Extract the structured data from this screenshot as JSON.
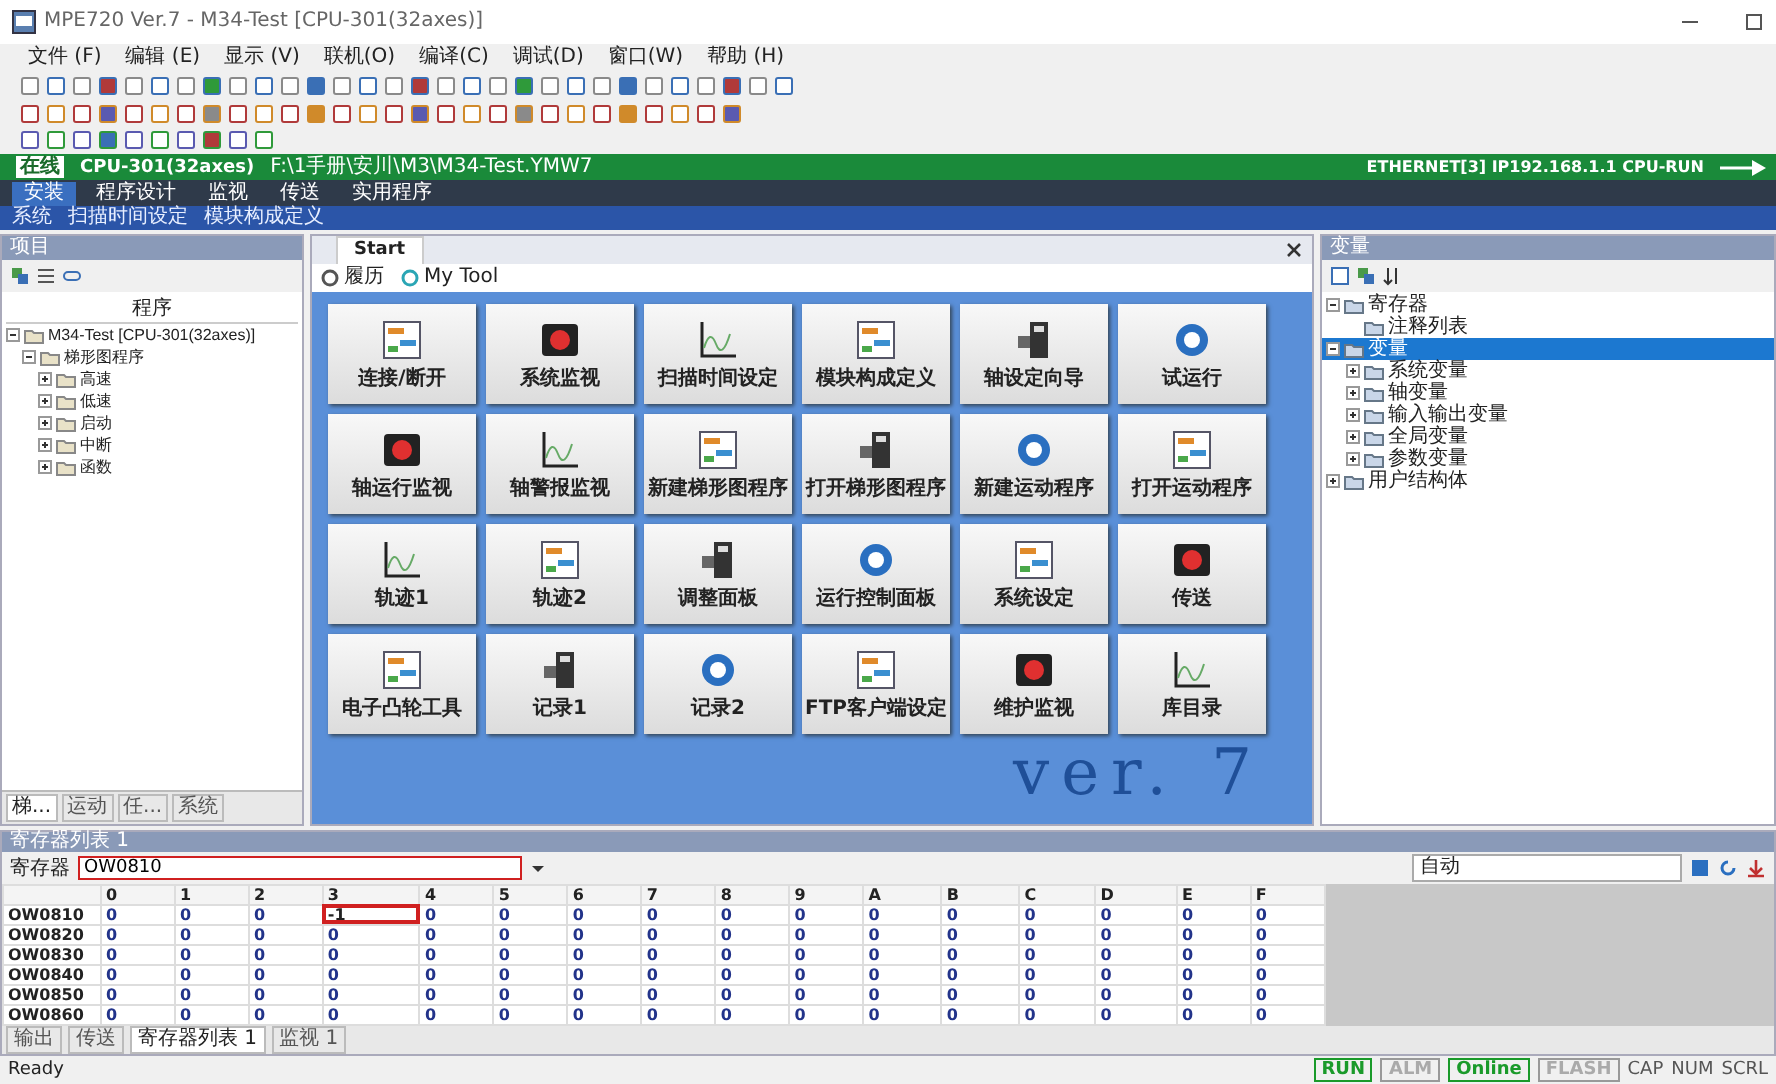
{
  "window": {
    "title": "MPE720 Ver.7 - M34-Test [CPU-301(32axes)]"
  },
  "menu": [
    "文件 (F)",
    "编辑 (E)",
    "显示 (V)",
    "联机(O)",
    "编译(C)",
    "调试(D)",
    "窗口(W)",
    "帮助 (H)"
  ],
  "connection_bar": {
    "state": "在线",
    "cpu": "CPU-301(32axes)",
    "path": "F:\\1手册\\安川\\M3\\M34-Test.YMW7",
    "link": "ETHERNET[3] IP192.168.1.1 CPU-RUN"
  },
  "ribbon": {
    "tabs": [
      {
        "label": "安装",
        "selected": true
      },
      {
        "label": "程序设计",
        "selected": false
      },
      {
        "label": "监视",
        "selected": false
      },
      {
        "label": "传送",
        "selected": false
      },
      {
        "label": "实用程序",
        "selected": false
      }
    ],
    "commands": [
      "系统",
      "扫描时间设定",
      "模块构成定义"
    ]
  },
  "left_panel": {
    "title": "项目",
    "tree_header": "程序",
    "tree": [
      {
        "label": "M34-Test [CPU-301(32axes)]",
        "expanded": true,
        "selected": false,
        "children": [
          {
            "label": "梯形图程序",
            "expanded": true,
            "selected": false,
            "children": [
              {
                "label": "高速",
                "expanded": false,
                "selected": false
              },
              {
                "label": "低速",
                "expanded": false,
                "selected": false
              },
              {
                "label": "启动",
                "expanded": false,
                "selected": false
              },
              {
                "label": "中断",
                "expanded": false,
                "selected": false
              },
              {
                "label": "函数",
                "expanded": false,
                "selected": false
              }
            ]
          }
        ]
      }
    ],
    "tabs": [
      {
        "label": "梯...",
        "selected": true
      },
      {
        "label": "运动",
        "selected": false
      },
      {
        "label": "任...",
        "selected": false
      },
      {
        "label": "系统",
        "selected": false
      }
    ]
  },
  "start_page": {
    "tab": "Start",
    "links": [
      "履历",
      "My Tool"
    ],
    "watermark": "ver. 7",
    "tiles": [
      {
        "label": "连接/断开"
      },
      {
        "label": "系统监视"
      },
      {
        "label": "扫描时间设定"
      },
      {
        "label": "模块构成定义"
      },
      {
        "label": "轴设定向导"
      },
      {
        "label": "试运行"
      },
      {
        "label": "轴运行监视"
      },
      {
        "label": "轴警报监视"
      },
      {
        "label": "新建梯形图程序"
      },
      {
        "label": "打开梯形图程序"
      },
      {
        "label": "新建运动程序"
      },
      {
        "label": "打开运动程序"
      },
      {
        "label": "轨迹1"
      },
      {
        "label": "轨迹2"
      },
      {
        "label": "调整面板"
      },
      {
        "label": "运行控制面板"
      },
      {
        "label": "系统设定"
      },
      {
        "label": "传送"
      },
      {
        "label": "电子凸轮工具"
      },
      {
        "label": "记录1"
      },
      {
        "label": "记录2"
      },
      {
        "label": "FTP客户端设定"
      },
      {
        "label": "维护监视"
      },
      {
        "label": "库目录"
      }
    ]
  },
  "right_panel": {
    "title": "变量",
    "tree": [
      {
        "label": "寄存器",
        "expanded": true,
        "selected": false,
        "children": [
          {
            "label": "注释列表",
            "selected": false
          }
        ]
      },
      {
        "label": "变量",
        "expanded": true,
        "selected": true,
        "children": [
          {
            "label": "系统变量",
            "expanded": false,
            "selected": false
          },
          {
            "label": "轴变量",
            "expanded": false,
            "selected": false
          },
          {
            "label": "输入输出变量",
            "expanded": false,
            "selected": false
          },
          {
            "label": "全局变量",
            "expanded": false,
            "selected": false
          },
          {
            "label": "参数变量",
            "expanded": false,
            "selected": false
          }
        ]
      },
      {
        "label": "用户结构体",
        "expanded": false,
        "selected": false
      }
    ]
  },
  "register_list": {
    "title": "寄存器列表 1",
    "register_label": "寄存器",
    "register_value": "OW0810",
    "mode": "自动",
    "columns": [
      "0",
      "1",
      "2",
      "3",
      "4",
      "5",
      "6",
      "7",
      "8",
      "9",
      "A",
      "B",
      "C",
      "D",
      "E",
      "F"
    ],
    "rows": [
      {
        "address": "OW0810",
        "cells": [
          {
            "value": "0",
            "selected": false
          },
          {
            "value": "0",
            "selected": false
          },
          {
            "value": "0",
            "selected": false
          },
          {
            "value": "-1",
            "selected": true
          },
          {
            "value": "0",
            "selected": false
          },
          {
            "value": "0",
            "selected": false
          },
          {
            "value": "0",
            "selected": false
          },
          {
            "value": "0",
            "selected": false
          },
          {
            "value": "0",
            "selected": false
          },
          {
            "value": "0",
            "selected": false
          },
          {
            "value": "0",
            "selected": false
          },
          {
            "value": "0",
            "selected": false
          },
          {
            "value": "0",
            "selected": false
          },
          {
            "value": "0",
            "selected": false
          },
          {
            "value": "0",
            "selected": false
          },
          {
            "value": "0",
            "selected": false
          }
        ]
      },
      {
        "address": "OW0820",
        "cells": [
          {
            "value": "0",
            "selected": false
          },
          {
            "value": "0",
            "selected": false
          },
          {
            "value": "0",
            "selected": false
          },
          {
            "value": "0",
            "selected": false
          },
          {
            "value": "0",
            "selected": false
          },
          {
            "value": "0",
            "selected": false
          },
          {
            "value": "0",
            "selected": false
          },
          {
            "value": "0",
            "selected": false
          },
          {
            "value": "0",
            "selected": false
          },
          {
            "value": "0",
            "selected": false
          },
          {
            "value": "0",
            "selected": false
          },
          {
            "value": "0",
            "selected": false
          },
          {
            "value": "0",
            "selected": false
          },
          {
            "value": "0",
            "selected": false
          },
          {
            "value": "0",
            "selected": false
          },
          {
            "value": "0",
            "selected": false
          }
        ]
      },
      {
        "address": "OW0830",
        "cells": [
          {
            "value": "0",
            "selected": false
          },
          {
            "value": "0",
            "selected": false
          },
          {
            "value": "0",
            "selected": false
          },
          {
            "value": "0",
            "selected": false
          },
          {
            "value": "0",
            "selected": false
          },
          {
            "value": "0",
            "selected": false
          },
          {
            "value": "0",
            "selected": false
          },
          {
            "value": "0",
            "selected": false
          },
          {
            "value": "0",
            "selected": false
          },
          {
            "value": "0",
            "selected": false
          },
          {
            "value": "0",
            "selected": false
          },
          {
            "value": "0",
            "selected": false
          },
          {
            "value": "0",
            "selected": false
          },
          {
            "value": "0",
            "selected": false
          },
          {
            "value": "0",
            "selected": false
          },
          {
            "value": "0",
            "selected": false
          }
        ]
      },
      {
        "address": "OW0840",
        "cells": [
          {
            "value": "0",
            "selected": false
          },
          {
            "value": "0",
            "selected": false
          },
          {
            "value": "0",
            "selected": false
          },
          {
            "value": "0",
            "selected": false
          },
          {
            "value": "0",
            "selected": false
          },
          {
            "value": "0",
            "selected": false
          },
          {
            "value": "0",
            "selected": false
          },
          {
            "value": "0",
            "selected": false
          },
          {
            "value": "0",
            "selected": false
          },
          {
            "value": "0",
            "selected": false
          },
          {
            "value": "0",
            "selected": false
          },
          {
            "value": "0",
            "selected": false
          },
          {
            "value": "0",
            "selected": false
          },
          {
            "value": "0",
            "selected": false
          },
          {
            "value": "0",
            "selected": false
          },
          {
            "value": "0",
            "selected": false
          }
        ]
      },
      {
        "address": "OW0850",
        "cells": [
          {
            "value": "0",
            "selected": false
          },
          {
            "value": "0",
            "selected": false
          },
          {
            "value": "0",
            "selected": false
          },
          {
            "value": "0",
            "selected": false
          },
          {
            "value": "0",
            "selected": false
          },
          {
            "value": "0",
            "selected": false
          },
          {
            "value": "0",
            "selected": false
          },
          {
            "value": "0",
            "selected": false
          },
          {
            "value": "0",
            "selected": false
          },
          {
            "value": "0",
            "selected": false
          },
          {
            "value": "0",
            "selected": false
          },
          {
            "value": "0",
            "selected": false
          },
          {
            "value": "0",
            "selected": false
          },
          {
            "value": "0",
            "selected": false
          },
          {
            "value": "0",
            "selected": false
          },
          {
            "value": "0",
            "selected": false
          }
        ]
      },
      {
        "address": "OW0860",
        "cells": [
          {
            "value": "0",
            "selected": false
          },
          {
            "value": "0",
            "selected": false
          },
          {
            "value": "0",
            "selected": false
          },
          {
            "value": "0",
            "selected": false
          },
          {
            "value": "0",
            "selected": false
          },
          {
            "value": "0",
            "selected": false
          },
          {
            "value": "0",
            "selected": false
          },
          {
            "value": "0",
            "selected": false
          },
          {
            "value": "0",
            "selected": false
          },
          {
            "value": "0",
            "selected": false
          },
          {
            "value": "0",
            "selected": false
          },
          {
            "value": "0",
            "selected": false
          },
          {
            "value": "0",
            "selected": false
          },
          {
            "value": "0",
            "selected": false
          },
          {
            "value": "0",
            "selected": false
          },
          {
            "value": "0",
            "selected": false
          }
        ]
      }
    ]
  },
  "output_tabs": [
    {
      "label": "输出",
      "selected": false
    },
    {
      "label": "传送",
      "selected": false
    },
    {
      "label": "寄存器列表 1",
      "selected": true
    },
    {
      "label": "监视 1",
      "selected": false
    }
  ],
  "status_bar": {
    "text": "Ready",
    "indicators": [
      {
        "label": "RUN",
        "on": true
      },
      {
        "label": "ALM",
        "on": false
      },
      {
        "label": "Online",
        "on": true
      },
      {
        "label": "FLASH",
        "on": false
      }
    ],
    "keys": [
      "CAP",
      "NUM",
      "SCRL"
    ]
  }
}
